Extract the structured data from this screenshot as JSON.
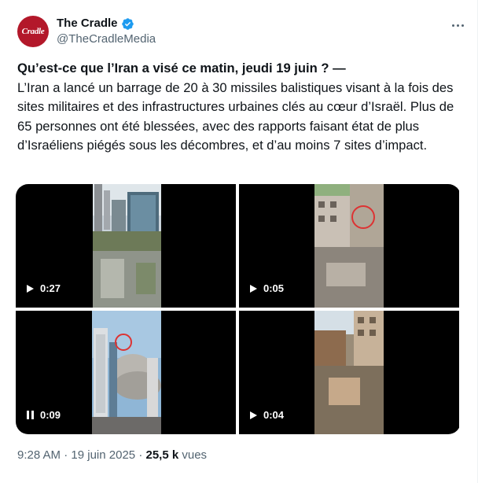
{
  "author": {
    "name": "The Cradle",
    "handle": "@TheCradleMedia",
    "avatar_text": "Cradle",
    "verified_icon": "verified-badge-icon",
    "brand_color": "#b3182a"
  },
  "tweet": {
    "title": "Qu’est-ce que l’Iran a visé ce matin, jeudi 19 juin ? —",
    "body": "L’Iran a lancé un barrage de 20 à 30 missiles balistiques visant à la fois des sites militaires et des infrastructures urbaines clés au cœur d’Israël. Plus de 65 personnes ont été blessées, avec des rapports faisant état de plus d’Israéliens piégés sous les décombres, et d’au moins 7 sites d’impact."
  },
  "media": [
    {
      "duration": "0:27",
      "state": "play"
    },
    {
      "duration": "0:05",
      "state": "play"
    },
    {
      "duration": "0:09",
      "state": "pause"
    },
    {
      "duration": "0:04",
      "state": "play"
    }
  ],
  "meta": {
    "time": "9:28 AM",
    "separator": "·",
    "date": "19 juin 2025",
    "views_count": "25,5 k",
    "views_label": "vues"
  }
}
